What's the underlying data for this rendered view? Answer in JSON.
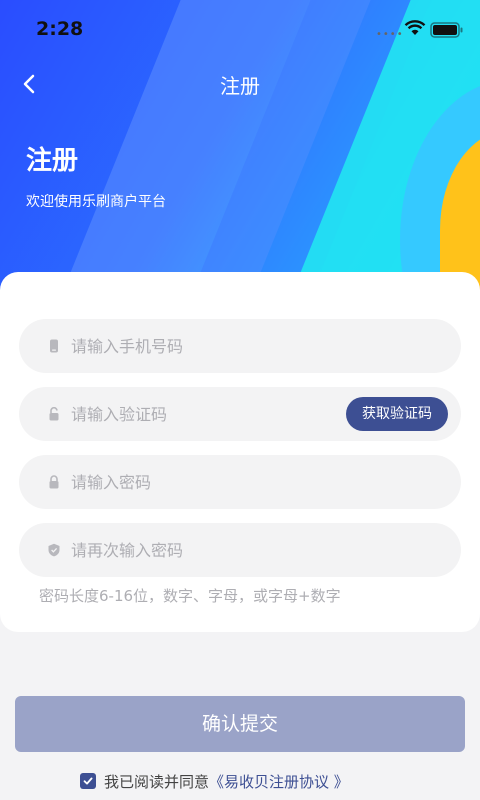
{
  "status_bar": {
    "time": "2:28",
    "signal_dots": "••••"
  },
  "navbar": {
    "title": "注册"
  },
  "hero": {
    "title": "注册",
    "subtitle": "欢迎使用乐刷商户平台"
  },
  "form": {
    "phone_placeholder": "请输入手机号码",
    "code_placeholder": "请输入验证码",
    "get_code_label": "获取验证码",
    "password_placeholder": "请输入密码",
    "confirm_placeholder": "请再次输入密码",
    "hint": "密码长度6-16位，数字、字母，或字母+数字"
  },
  "submit_label": "确认提交",
  "agreement": {
    "prefix": "我已阅读并同意",
    "link": "《易收贝注册协议 》",
    "checked": true
  },
  "colors": {
    "primary": "#3d4f93",
    "submit_disabled": "#9aa3c8",
    "hero_blue": "#2a4dff",
    "hero_cyan": "#22e4f2",
    "hero_yellow": "#ffc21a"
  }
}
